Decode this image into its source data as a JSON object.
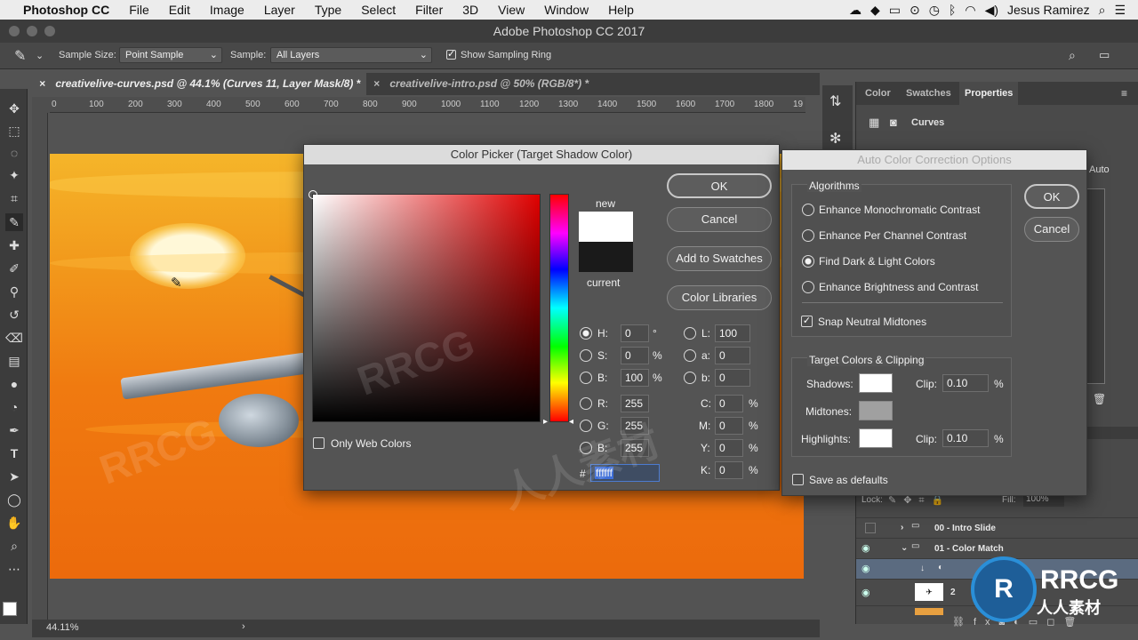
{
  "menubar": {
    "apple": "",
    "app": "Photoshop CC",
    "items": [
      "File",
      "Edit",
      "Image",
      "Layer",
      "Type",
      "Select",
      "Filter",
      "3D",
      "View",
      "Window",
      "Help"
    ],
    "user": "Jesus Ramirez"
  },
  "window": {
    "title": "Adobe Photoshop CC 2017"
  },
  "options": {
    "sample_size_label": "Sample Size:",
    "sample_size_value": "Point Sample",
    "sample_label": "Sample:",
    "sample_value": "All Layers",
    "show_ring_label": "Show Sampling Ring",
    "show_ring_checked": true
  },
  "tabs": [
    {
      "label": "creativelive-curves.psd @ 44.1% (Curves 11, Layer Mask/8) *",
      "active": true
    },
    {
      "label": "creativelive-intro.psd @ 50% (RGB/8*) *",
      "active": false
    }
  ],
  "ruler": [
    "0",
    "100",
    "200",
    "300",
    "400",
    "500",
    "600",
    "700",
    "800",
    "900",
    "1000",
    "1100",
    "1200",
    "1300",
    "1400",
    "1500",
    "1600",
    "1700",
    "1800",
    "19"
  ],
  "status": {
    "zoom": "44.11%"
  },
  "panels": {
    "tabs": [
      "Color",
      "Swatches",
      "Properties"
    ],
    "active": "Properties",
    "properties_title": "Curves",
    "auto_label": "Auto"
  },
  "color_picker": {
    "title": "Color Picker (Target Shadow Color)",
    "ok": "OK",
    "cancel": "Cancel",
    "add_swatches": "Add to Swatches",
    "color_libraries": "Color Libraries",
    "new_label": "new",
    "current_label": "current",
    "new_color": "#ffffff",
    "current_color": "#1a1a1a",
    "only_web": "Only Web Colors",
    "hsb": [
      {
        "label": "H:",
        "value": "0",
        "unit": "°",
        "selected": true
      },
      {
        "label": "S:",
        "value": "0",
        "unit": "%",
        "selected": false
      },
      {
        "label": "B:",
        "value": "100",
        "unit": "%",
        "selected": false
      }
    ],
    "rgb": [
      {
        "label": "R:",
        "value": "255"
      },
      {
        "label": "G:",
        "value": "255"
      },
      {
        "label": "B:",
        "value": "255"
      }
    ],
    "lab": [
      {
        "label": "L:",
        "value": "100"
      },
      {
        "label": "a:",
        "value": "0"
      },
      {
        "label": "b:",
        "value": "0"
      }
    ],
    "cmyk": [
      {
        "label": "C:",
        "value": "0",
        "unit": "%"
      },
      {
        "label": "M:",
        "value": "0",
        "unit": "%"
      },
      {
        "label": "Y:",
        "value": "0",
        "unit": "%"
      },
      {
        "label": "K:",
        "value": "0",
        "unit": "%"
      }
    ],
    "hex_label": "#",
    "hex": "ffffff"
  },
  "auto_options": {
    "title": "Auto Color Correction Options",
    "ok": "OK",
    "cancel": "Cancel",
    "algorithms_label": "Algorithms",
    "algorithms": [
      {
        "label": "Enhance Monochromatic Contrast",
        "selected": false
      },
      {
        "label": "Enhance Per Channel Contrast",
        "selected": false
      },
      {
        "label": "Find Dark & Light Colors",
        "selected": true
      },
      {
        "label": "Enhance Brightness and Contrast",
        "selected": false
      }
    ],
    "snap_label": "Snap Neutral Midtones",
    "snap_checked": true,
    "targets_label": "Target Colors & Clipping",
    "shadows_label": "Shadows:",
    "midtones_label": "Midtones:",
    "highlights_label": "Highlights:",
    "clip_label": "Clip:",
    "shadows_clip": "0.10",
    "highlights_clip": "0.10",
    "percent": "%",
    "shadows_color": "#ffffff",
    "midtones_color": "#a0a0a0",
    "highlights_color": "#ffffff",
    "save_defaults": "Save as defaults"
  },
  "layers": {
    "lock_label": "Lock:",
    "fill_label": "Fill:",
    "fill_value": "100%",
    "rows": [
      {
        "name": "00 - Intro Slide"
      },
      {
        "name": "01 - Color Match"
      },
      {
        "name": "rve"
      },
      {
        "name": "2"
      },
      {
        "name": ""
      }
    ]
  },
  "watermark": {
    "text": "RRCG",
    "subtext": "人人素材"
  }
}
